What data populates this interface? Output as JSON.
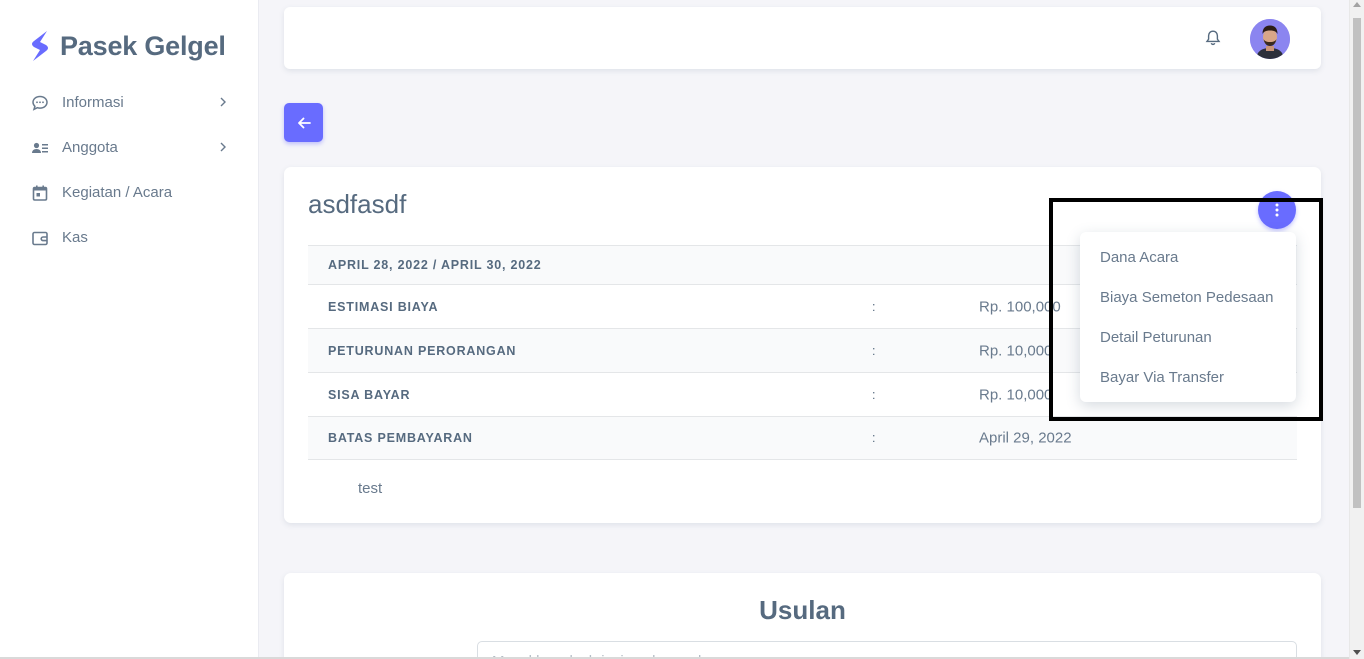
{
  "brand": {
    "name": "Pasek Gelgel",
    "accent_color": "#696cff"
  },
  "sidebar": {
    "items": [
      {
        "label": "Informasi",
        "icon": "chat-bubble-icon",
        "has_submenu": true
      },
      {
        "label": "Anggota",
        "icon": "user-list-icon",
        "has_submenu": true
      },
      {
        "label": "Kegiatan / Acara",
        "icon": "calendar-icon",
        "has_submenu": false
      },
      {
        "label": "Kas",
        "icon": "wallet-icon",
        "has_submenu": false
      }
    ]
  },
  "header": {
    "bell_icon": "bell-icon",
    "avatar": "user-avatar"
  },
  "event": {
    "title": "asdfasdf",
    "dates": "APRIL 28, 2022 / APRIL 30, 2022",
    "rows": [
      {
        "label": "ESTIMASI BIAYA",
        "colon": ":",
        "value": "Rp. 100,000"
      },
      {
        "label": "PETURUNAN PERORANGAN",
        "colon": ":",
        "value": "Rp. 10,000"
      },
      {
        "label": "SISA BAYAR",
        "colon": ":",
        "value": "Rp. 10,000"
      },
      {
        "label": "BATAS PEMBAYARAN",
        "colon": ":",
        "value": "April 29, 2022"
      }
    ],
    "note": "test"
  },
  "dropdown": {
    "items": [
      "Dana Acara",
      "Biaya Semeton Pedesaan",
      "Detail Peturunan",
      "Bayar Via Transfer"
    ]
  },
  "usulan": {
    "title": "Usulan",
    "placeholder": "Masukkan deskripsi usulan anda"
  }
}
